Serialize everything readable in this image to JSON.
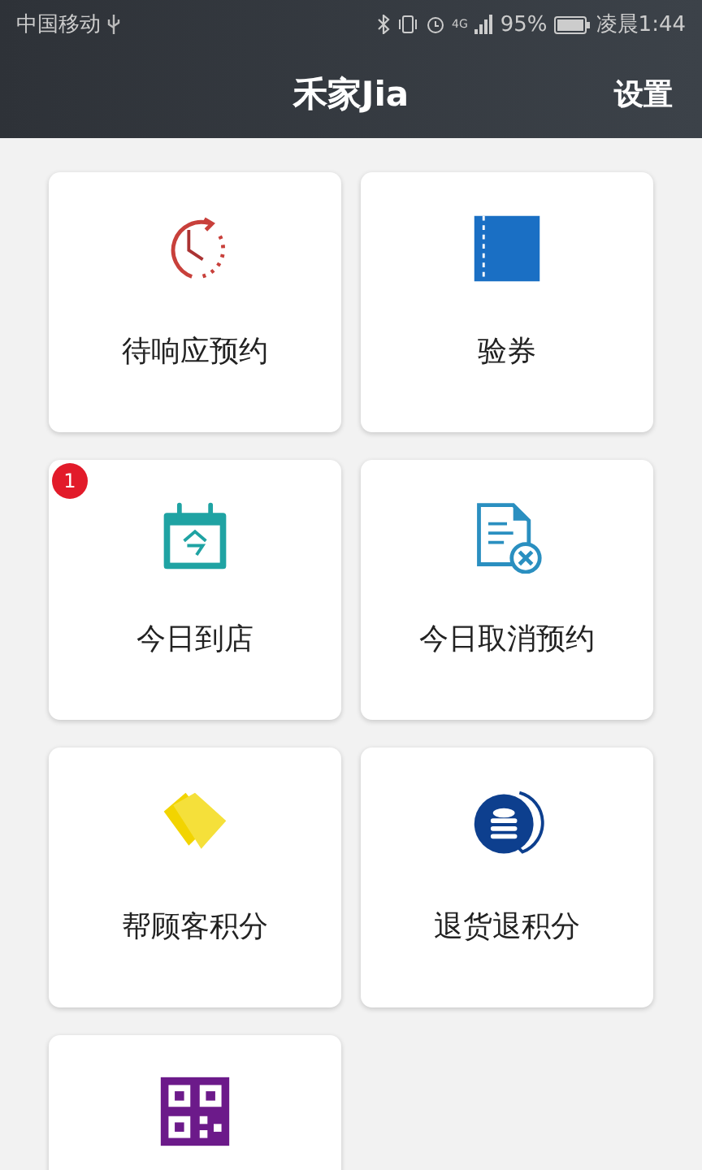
{
  "status_bar": {
    "carrier": "中国移动",
    "signal_type": "4G",
    "battery": "95%",
    "time": "凌晨1:44"
  },
  "header": {
    "title": "禾家Jia",
    "settings": "设置"
  },
  "tiles": [
    {
      "kind": "tile",
      "label": "待响应预约"
    },
    {
      "kind": "tile",
      "label": "验券"
    },
    {
      "kind": "tile",
      "label": "今日到店",
      "badge": "1"
    },
    {
      "kind": "tile",
      "label": "今日取消预约"
    },
    {
      "kind": "tile",
      "label": "帮顾客积分"
    },
    {
      "kind": "tile",
      "label": "退货退积分"
    },
    {
      "kind": "tile"
    }
  ]
}
